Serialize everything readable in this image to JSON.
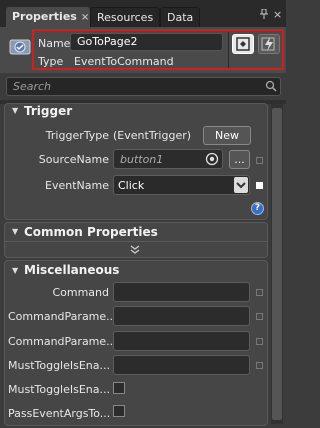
{
  "tabs": [
    {
      "label": "Properties",
      "close": "×"
    },
    {
      "label": "Resources"
    },
    {
      "label": "Data"
    }
  ],
  "header": {
    "name_label": "Name",
    "name_value": "GoToPage2",
    "type_label": "Type",
    "type_value": "EventToCommand"
  },
  "search": {
    "placeholder": "Search"
  },
  "trigger": {
    "title": "Trigger",
    "trigger_type_label": "TriggerType",
    "trigger_type_value": "(EventTrigger)",
    "new_button": "New",
    "source_name_label": "SourceName",
    "source_name_value": "button1",
    "browse_button": "...",
    "event_name_label": "EventName",
    "event_name_value": "Click",
    "help": "?"
  },
  "common": {
    "title": "Common Properties"
  },
  "misc": {
    "title": "Miscellaneous",
    "rows": [
      {
        "label": "Command"
      },
      {
        "label": "CommandParame..."
      },
      {
        "label": "CommandParame..."
      },
      {
        "label": "MustToggleIsEna..."
      },
      {
        "label": "MustToggleIsEna..."
      },
      {
        "label": "PassEventArgsTo..."
      }
    ]
  },
  "colors": {
    "highlight": "#d0201e",
    "panel": "#3c3c3c",
    "section": "#464646"
  }
}
